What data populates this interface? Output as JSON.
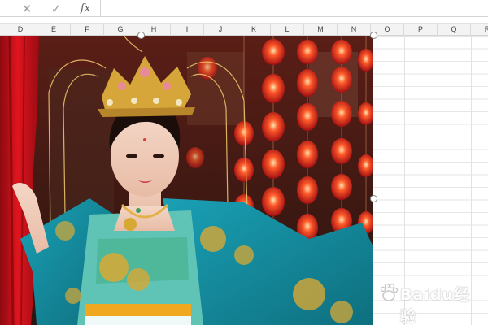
{
  "formula_bar": {
    "cancel_icon": "close-icon",
    "enter_icon": "checkmark-icon",
    "fx_label": "fx",
    "formula_value": ""
  },
  "columns": [
    "D",
    "E",
    "F",
    "G",
    "H",
    "I",
    "J",
    "K",
    "L",
    "M",
    "N",
    "O",
    "P",
    "Q",
    "R"
  ],
  "picture": {
    "subject": "woman-in-tang-costume-photo",
    "dominant_colors": [
      "#c8102e",
      "#1e8fa0",
      "#d4a43a",
      "#2a1510"
    ]
  },
  "watermark": {
    "text": "Baidu经验"
  }
}
